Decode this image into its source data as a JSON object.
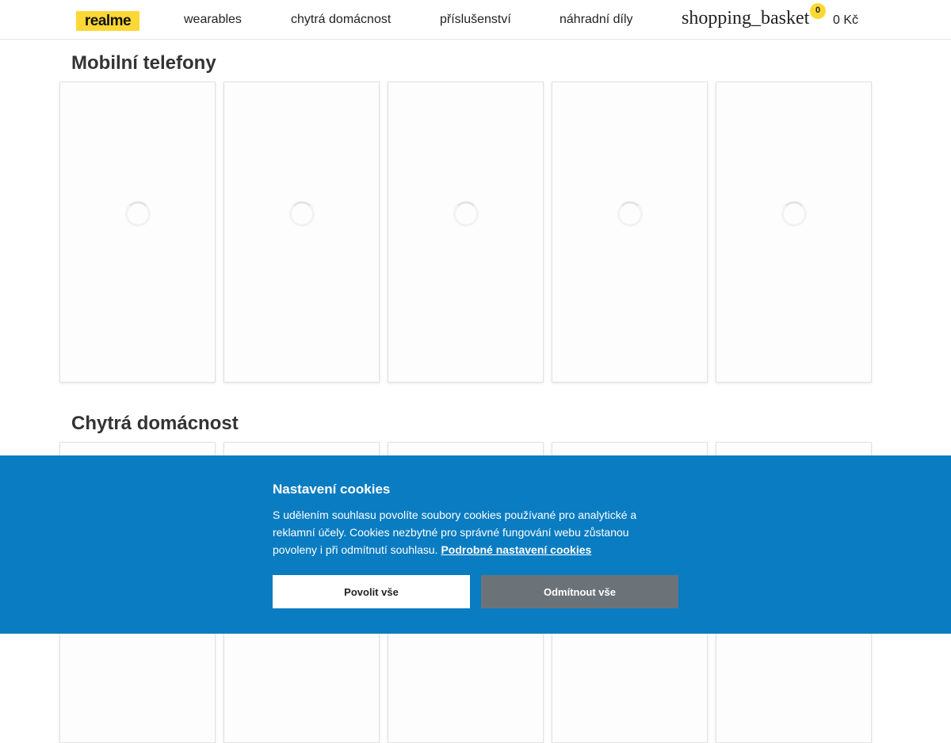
{
  "header": {
    "logo_text": "realme",
    "nav": [
      "wearables",
      "chytrá domácnost",
      "příslušenství",
      "náhradní díly"
    ],
    "basket_label": "shopping_basket",
    "basket_count": "0",
    "basket_total": "0 Kč"
  },
  "sections": [
    {
      "title": "Mobilní telefony"
    },
    {
      "title": "Chytrá domácnost"
    }
  ],
  "cookie_banner": {
    "title": "Nastavení cookies",
    "text": "S udělením souhlasu povolíte soubory cookies používané pro analytické a reklamní účely. Cookies nezbytné pro správné fungování webu zůstanou povoleny i při odmítnutí souhlasu.",
    "link_text": "Podrobné nastavení cookies",
    "accept_label": "Povolit vše",
    "reject_label": "Odmítnout vše"
  },
  "colors": {
    "brand_yellow": "#fdd835",
    "cookie_bg": "#0a7cc1",
    "reject_button": "#6c7378"
  }
}
